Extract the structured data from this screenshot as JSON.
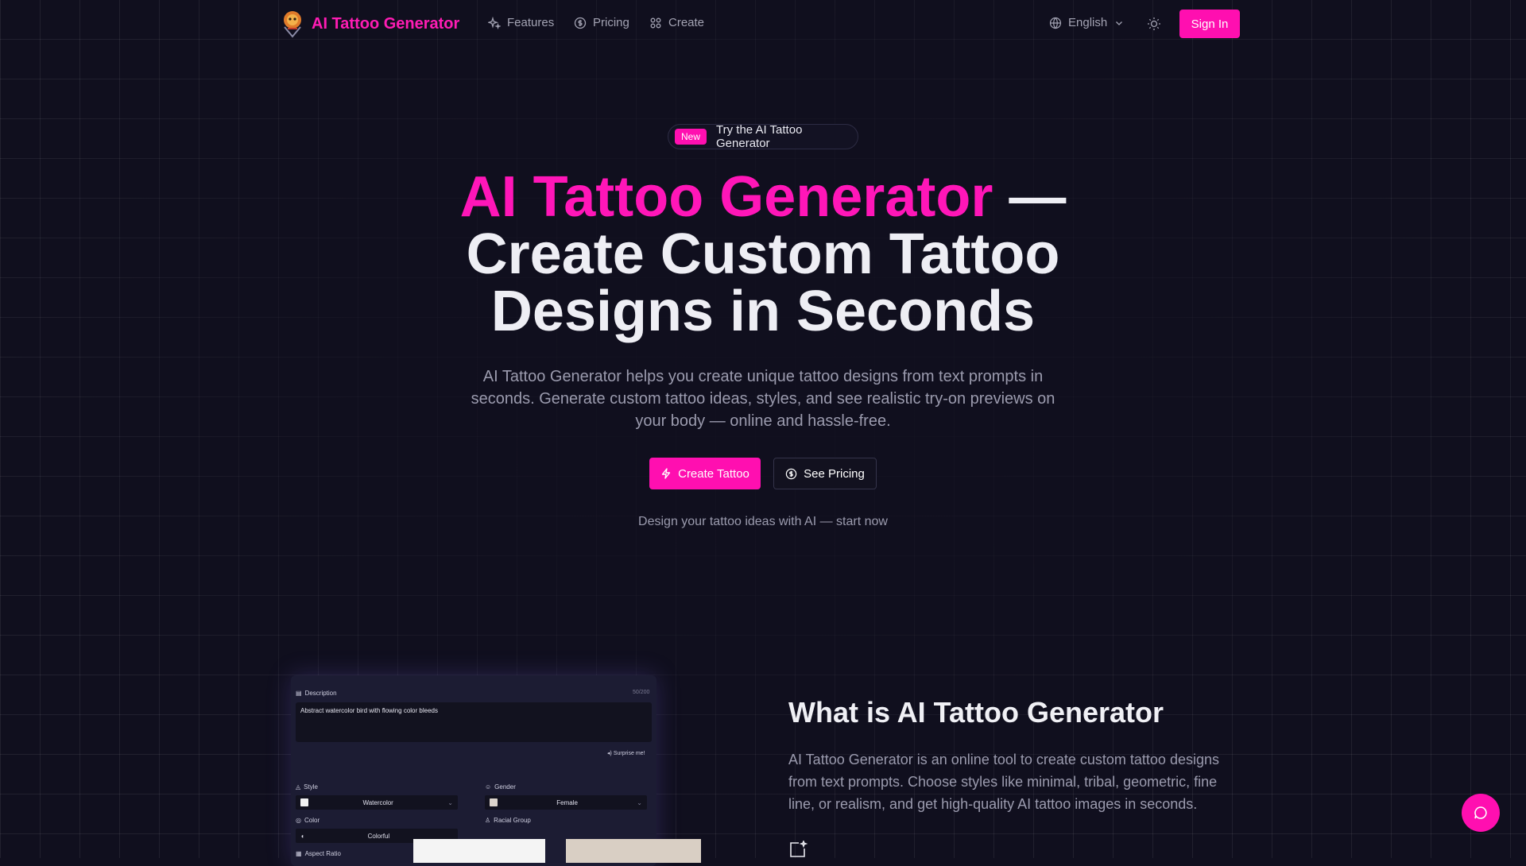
{
  "nav": {
    "brand": "AI Tattoo Generator",
    "links": [
      {
        "label": "Features",
        "icon": "sparkles-icon"
      },
      {
        "label": "Pricing",
        "icon": "dollar-circle-icon"
      },
      {
        "label": "Create",
        "icon": "grid-icon"
      }
    ],
    "language": "English",
    "sign_in": "Sign In"
  },
  "hero": {
    "badge_tag": "New",
    "badge_text": "Try the AI Tattoo Generator",
    "headline_accent": "AI Tattoo Generator",
    "headline_rest": " — Create Custom Tattoo Designs in Seconds",
    "subtitle": "AI Tattoo Generator helps you create unique tattoo designs from text prompts in seconds. Generate custom tattoo ideas, styles, and see realistic try-on previews on your body — online and hassle-free.",
    "primary_button": "Create Tattoo",
    "secondary_button": "See Pricing",
    "tagline": "Design your tattoo ideas with AI — start now"
  },
  "preview": {
    "description_label": "Description",
    "char_count": "50/200",
    "description_value": "Abstract watercolor bird with flowing color bleeds",
    "surprise": "Surprise me!",
    "style_label": "Style",
    "style_value": "Watercolor",
    "gender_label": "Gender",
    "gender_value": "Female",
    "racial_label": "Racial Group",
    "color_label": "Color",
    "color_value": "Colorful",
    "aspect_label": "Aspect Ratio"
  },
  "section": {
    "title": "What is AI Tattoo Generator",
    "body": "AI Tattoo Generator is an online tool to create custom tattoo designs from text prompts. Choose styles like minimal, tribal, geometric, fine line, or realism, and get high-quality AI tattoo images in seconds."
  },
  "colors": {
    "accent": "#ff0fb0",
    "background": "#100f1e"
  }
}
